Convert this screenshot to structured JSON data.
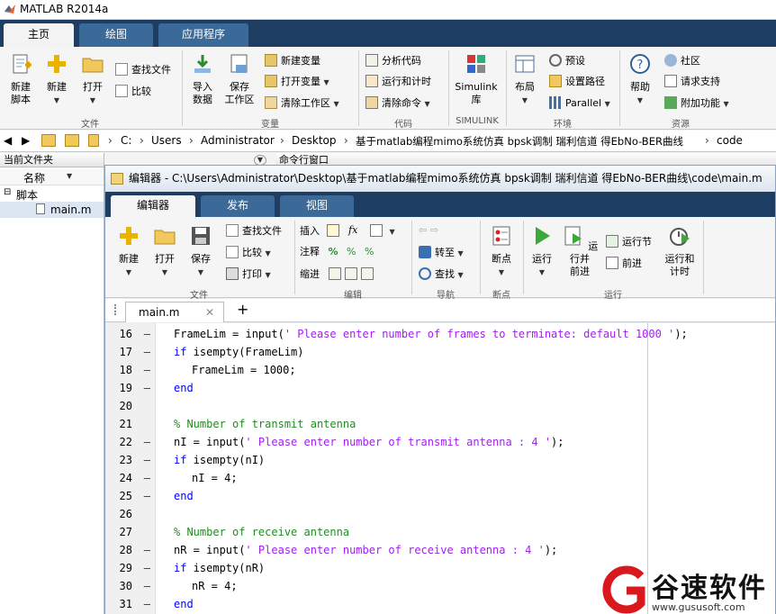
{
  "app": {
    "title": "MATLAB R2014a"
  },
  "main_tabs": [
    "主页",
    "绘图",
    "应用程序"
  ],
  "ribbon": {
    "new_script": "新建\n脚本",
    "new": "新建",
    "open": "打开",
    "find_files": "查找文件",
    "compare": "比较",
    "import": "导入\n数据",
    "save_ws": "保存\n工作区",
    "new_var": "新建变量",
    "open_var": "打开变量",
    "clear_ws": "清除工作区",
    "analyze": "分析代码",
    "run_time": "运行和计时",
    "clear_cmd": "清除命令",
    "simulink": "Simulink\n库",
    "layout": "布局",
    "prefs": "预设",
    "set_path": "设置路径",
    "parallel": "Parallel",
    "help": "帮助",
    "community": "社区",
    "request_support": "请求支持",
    "addons": "附加功能",
    "sections": {
      "file": "文件",
      "variable": "变量",
      "code": "代码",
      "simulink": "SIMULINK",
      "env": "环境",
      "resources": "资源"
    }
  },
  "address": {
    "parts": [
      "C:",
      "Users",
      "Administrator",
      "Desktop",
      "基于matlab编程mimo系统仿真 bpsk调制 瑞利信道 得EbNo-BER曲线",
      "code"
    ]
  },
  "left_panel": {
    "header": "当前文件夹",
    "col_name": "名称",
    "group": "脚本",
    "file": "main.m"
  },
  "cmd_header": "命令行窗口",
  "editor": {
    "title": "编辑器 - C:\\Users\\Administrator\\Desktop\\基于matlab编程mimo系统仿真 bpsk调制 瑞利信道 得EbNo-BER曲线\\code\\main.m",
    "tabs": [
      "编辑器",
      "发布",
      "视图"
    ],
    "ribbon": {
      "new": "新建",
      "open": "打开",
      "save": "保存",
      "find_files": "查找文件",
      "compare": "比较",
      "print": "打印",
      "insert": "插入",
      "fx": "fx",
      "comment": "注释",
      "indent": "缩进",
      "goto": "转至",
      "find": "查找",
      "breakpoints": "断点",
      "run": "运行",
      "run_advance": "运行并\n前进",
      "run_section": "运行节",
      "advance": "前进",
      "run_time": "运行和\n计时",
      "sections": {
        "file": "文件",
        "edit": "编辑",
        "nav": "导航",
        "bp": "断点",
        "run": "运行"
      }
    },
    "file_tab": "main.m",
    "lines": [
      {
        "n": "16",
        "parts": [
          [
            "FrameLim = input(",
            ""
          ],
          [
            "' Please enter number of frames to terminate: default 1000 '",
            "str"
          ],
          [
            ");",
            ""
          ]
        ],
        "indent": 0
      },
      {
        "n": "17",
        "parts": [
          [
            "if",
            "kw"
          ],
          [
            " isempty(FrameLim)",
            ""
          ]
        ],
        "indent": 0
      },
      {
        "n": "18",
        "parts": [
          [
            "FrameLim = 1000;",
            ""
          ]
        ],
        "indent": 1
      },
      {
        "n": "19",
        "parts": [
          [
            "end",
            "kw"
          ]
        ],
        "indent": 0
      },
      {
        "n": "20",
        "parts": [],
        "indent": 0,
        "nodash": true
      },
      {
        "n": "21",
        "parts": [
          [
            "% Number of transmit antenna",
            "cm"
          ]
        ],
        "indent": 0,
        "nodash": true
      },
      {
        "n": "22",
        "parts": [
          [
            "nI = input(",
            ""
          ],
          [
            "' Please enter number of transmit antenna : 4 '",
            "str"
          ],
          [
            ");",
            ""
          ]
        ],
        "indent": 0
      },
      {
        "n": "23",
        "parts": [
          [
            "if",
            "kw"
          ],
          [
            " isempty(nI)",
            ""
          ]
        ],
        "indent": 0
      },
      {
        "n": "24",
        "parts": [
          [
            "nI = 4;",
            ""
          ]
        ],
        "indent": 1
      },
      {
        "n": "25",
        "parts": [
          [
            "end",
            "kw"
          ]
        ],
        "indent": 0
      },
      {
        "n": "26",
        "parts": [],
        "indent": 0,
        "nodash": true
      },
      {
        "n": "27",
        "parts": [
          [
            "% Number of receive antenna",
            "cm"
          ]
        ],
        "indent": 0,
        "nodash": true
      },
      {
        "n": "28",
        "parts": [
          [
            "nR = input(",
            ""
          ],
          [
            "' Please enter number of receive antenna : 4 '",
            "str"
          ],
          [
            ");",
            ""
          ]
        ],
        "indent": 0
      },
      {
        "n": "29",
        "parts": [
          [
            "if",
            "kw"
          ],
          [
            " isempty(nR)",
            ""
          ]
        ],
        "indent": 0
      },
      {
        "n": "30",
        "parts": [
          [
            "nR = 4;",
            ""
          ]
        ],
        "indent": 1
      },
      {
        "n": "31",
        "parts": [
          [
            "end",
            "kw"
          ]
        ],
        "indent": 0
      }
    ]
  },
  "watermark": {
    "name": "谷速软件",
    "url": "www.gususoft.com"
  }
}
